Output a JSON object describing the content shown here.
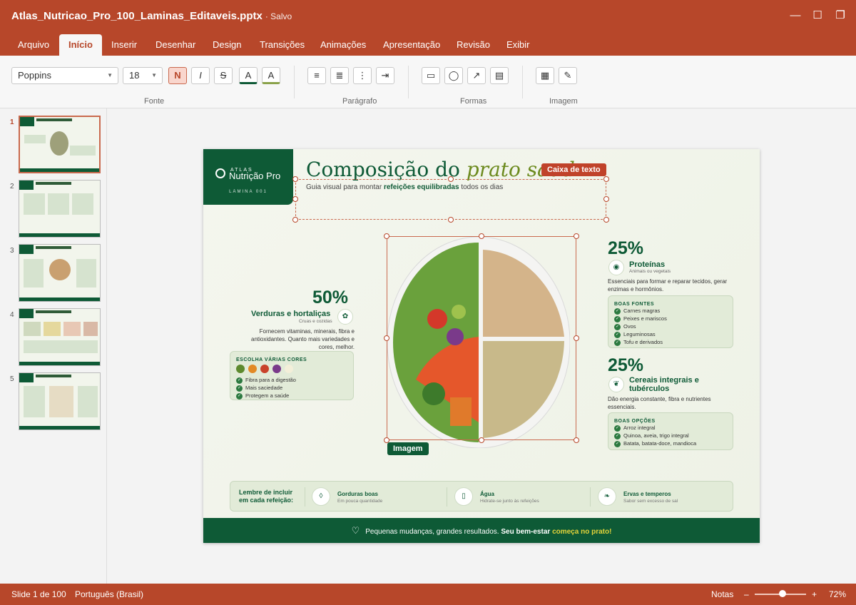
{
  "titlebar": {
    "filename": "Atlas_Nutricao_Pro_100_Laminas_Editaveis.pptx",
    "saved": "· Salvo",
    "min": "—",
    "max": "☐",
    "restore": "❐"
  },
  "tabs": [
    "Arquivo",
    "Início",
    "Inserir",
    "Desenhar",
    "Design",
    "Transições",
    "Animações",
    "Apresentação",
    "Revisão",
    "Exibir"
  ],
  "ribbon": {
    "font_name": "Poppins",
    "font_size": "18",
    "bold": "N",
    "italic": "I",
    "strike": "S",
    "color_a": "A",
    "highlight_a": "A",
    "groups": {
      "fonte": "Fonte",
      "paragrafo": "Parágrafo",
      "formas": "Formas",
      "imagem": "Imagem"
    },
    "icons": {
      "bullets": "≡",
      "numbers": "≣",
      "more": "⋮",
      "indent": "⇥",
      "rect": "▭",
      "circle": "◯",
      "arrow": "↗",
      "frame": "▤",
      "img": "▦",
      "brush": "✎"
    }
  },
  "thumbs": [
    "1",
    "2",
    "3",
    "4",
    "5"
  ],
  "slide": {
    "logo_top": "ATLAS",
    "logo_name": "Nutrição Pro",
    "logo_sub": "LÂMINA 001",
    "title_a": "Composição do ",
    "title_b": "prato saud",
    "subtitle_a": "Guia visual para montar ",
    "subtitle_b": "refeições equilibradas",
    "subtitle_c": " todos os dias",
    "tag_text": "Caixa de texto",
    "tag_image": "Imagem",
    "veg": {
      "pct": "50%",
      "title": "Verduras e hortaliças",
      "sub": "Cruas e cozidas",
      "desc": "Fornecem vitaminas, minerais, fibra e antioxidantes. Quanto mais variedades e cores, melhor.",
      "card_title": "ESCOLHA VÁRIAS CORES",
      "colors": [
        "#5d8a2e",
        "#e28a26",
        "#c9432b",
        "#7a3a8a",
        "#f3efd9"
      ],
      "items": [
        "Fibra para a digestão",
        "Mais saciedade",
        "Protegem a saúde"
      ]
    },
    "prot": {
      "pct": "25%",
      "title": "Proteínas",
      "sub": "Animais ou vegetais",
      "desc": "Essenciais para formar e reparar tecidos, gerar enzimas e hormônios.",
      "card_title": "BOAS FONTES",
      "items": [
        "Carnes magras",
        "Peixes e mariscos",
        "Ovos",
        "Leguminosas",
        "Tofu e derivados"
      ]
    },
    "carb": {
      "pct": "25%",
      "title": "Cereais integrais e tubérculos",
      "desc": "Dão energia constante, fibra e nutrientes essenciais.",
      "card_title": "BOAS OPÇÕES",
      "items": [
        "Arroz integral",
        "Quinoa, aveia, trigo integral",
        "Batata, batata-doce, mandioca"
      ]
    },
    "tip": {
      "label": "Lembre de incluir em cada refeição:",
      "items": [
        {
          "t": "Gorduras boas",
          "s": "Em pouca quantidade"
        },
        {
          "t": "Água",
          "s": "Hidrate-se junto às refeições"
        },
        {
          "t": "Ervas e temperos",
          "s": "Sabor sem excesso de sal"
        }
      ]
    },
    "footer_a": "Pequenas mudanças, grandes resultados. ",
    "footer_b": "Seu bem-estar ",
    "footer_c": "começa no prato!",
    "heart": "♡"
  },
  "status": {
    "slide": "Slide 1 de 100",
    "lang": "Português (Brasil)",
    "notes": "Notas",
    "minus": "–",
    "plus": "+",
    "zoom": "72%"
  }
}
